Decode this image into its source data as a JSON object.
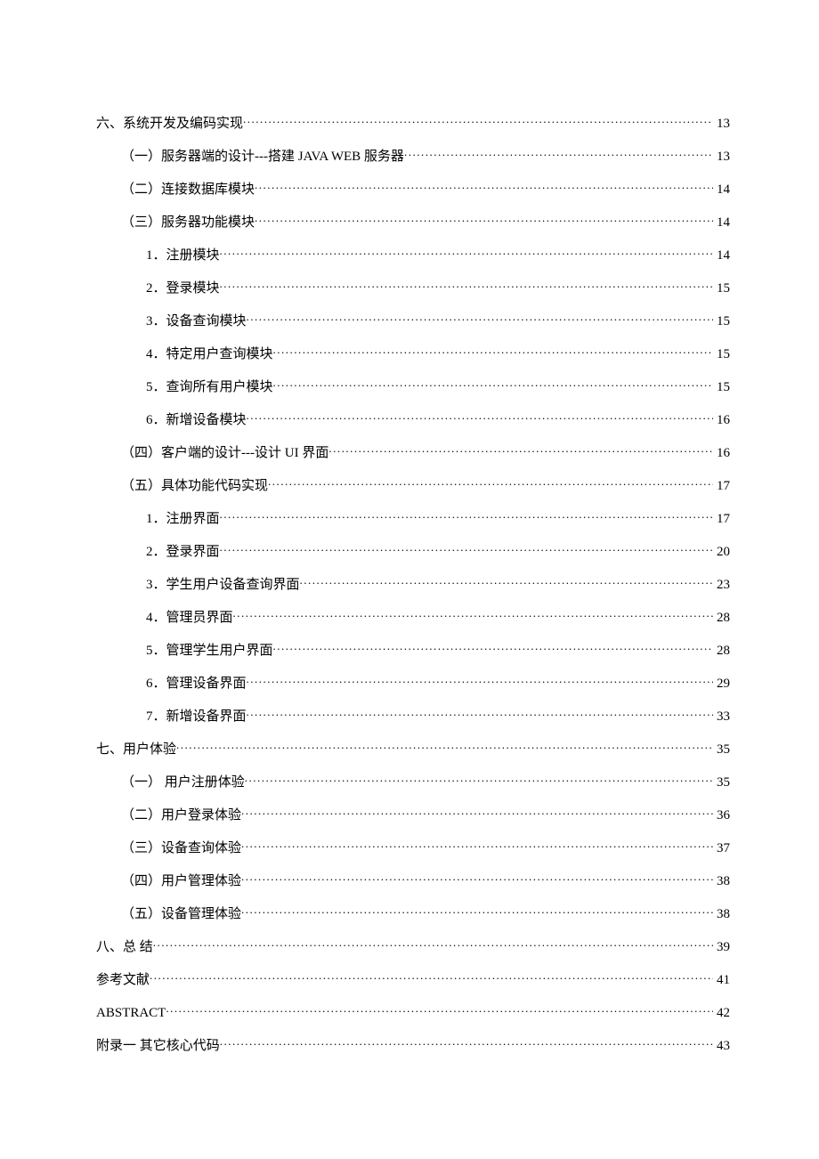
{
  "toc": [
    {
      "level": 0,
      "title": "六、系统开发及编码实现",
      "page": "13"
    },
    {
      "level": 1,
      "title": "（一）服务器端的设计---搭建 JAVA WEB 服务器",
      "page": "13"
    },
    {
      "level": 1,
      "title": "（二）连接数据库模块",
      "page": "14"
    },
    {
      "level": 1,
      "title": "（三）服务器功能模块",
      "page": "14"
    },
    {
      "level": 2,
      "title": "1．注册模块",
      "page": "14"
    },
    {
      "level": 2,
      "title": "2．登录模块",
      "page": "15"
    },
    {
      "level": 2,
      "title": "3．设备查询模块",
      "page": "15"
    },
    {
      "level": 2,
      "title": "4．特定用户查询模块",
      "page": "15"
    },
    {
      "level": 2,
      "title": "5．查询所有用户模块",
      "page": "15"
    },
    {
      "level": 2,
      "title": "6．新增设备模块",
      "page": "16"
    },
    {
      "level": 1,
      "title": "（四）客户端的设计---设计 UI 界面",
      "page": "16"
    },
    {
      "level": 1,
      "title": "（五）具体功能代码实现",
      "page": "17"
    },
    {
      "level": 2,
      "title": "1．注册界面",
      "page": "17"
    },
    {
      "level": 2,
      "title": "2．登录界面",
      "page": "20"
    },
    {
      "level": 2,
      "title": "3．学生用户设备查询界面",
      "page": "23"
    },
    {
      "level": 2,
      "title": "4．管理员界面",
      "page": "28"
    },
    {
      "level": 2,
      "title": "5．管理学生用户界面",
      "page": "28"
    },
    {
      "level": 2,
      "title": "6．管理设备界面",
      "page": "29"
    },
    {
      "level": 2,
      "title": "7．新增设备界面",
      "page": "33"
    },
    {
      "level": 0,
      "title": "七、用户体验",
      "page": "35"
    },
    {
      "level": 1,
      "title": "（一） 用户注册体验",
      "page": "35"
    },
    {
      "level": 1,
      "title": "（二）用户登录体验",
      "page": "36"
    },
    {
      "level": 1,
      "title": "（三）设备查询体验",
      "page": "37"
    },
    {
      "level": 1,
      "title": "（四）用户管理体验",
      "page": "38"
    },
    {
      "level": 1,
      "title": "（五）设备管理体验",
      "page": "38"
    },
    {
      "level": 0,
      "title": "八、总 结",
      "page": "39"
    },
    {
      "level": 0,
      "title": "参考文献",
      "page": "41"
    },
    {
      "level": 0,
      "title": "ABSTRACT",
      "page": "42"
    },
    {
      "level": 0,
      "title": "附录一 其它核心代码",
      "page": "43"
    }
  ]
}
